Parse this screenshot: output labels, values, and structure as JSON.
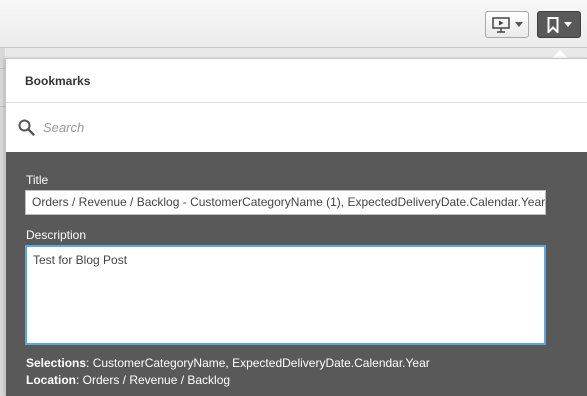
{
  "toolbar": {
    "present_icon": "present-icon",
    "bookmark_icon": "bookmark-icon",
    "caret_icon": "chevron-down-icon"
  },
  "bookmarks": {
    "header": "Bookmarks",
    "search": {
      "placeholder": "Search",
      "icon": "search-icon"
    },
    "form": {
      "title_label": "Title",
      "title_value": "Orders / Revenue / Backlog - CustomerCategoryName (1), ExpectedDeliveryDate.Calendar.Year",
      "description_label": "Description",
      "description_value": "Test for Blog Post",
      "selections_label": "Selections",
      "selections_value": ": CustomerCategoryName, ExpectedDeliveryDate.Calendar.Year",
      "location_label": "Location",
      "location_value": ": Orders / Revenue / Backlog"
    }
  },
  "colors": {
    "panel_dark": "#595959",
    "focus_border": "#5aa7e6",
    "button_dark": "#595959"
  }
}
